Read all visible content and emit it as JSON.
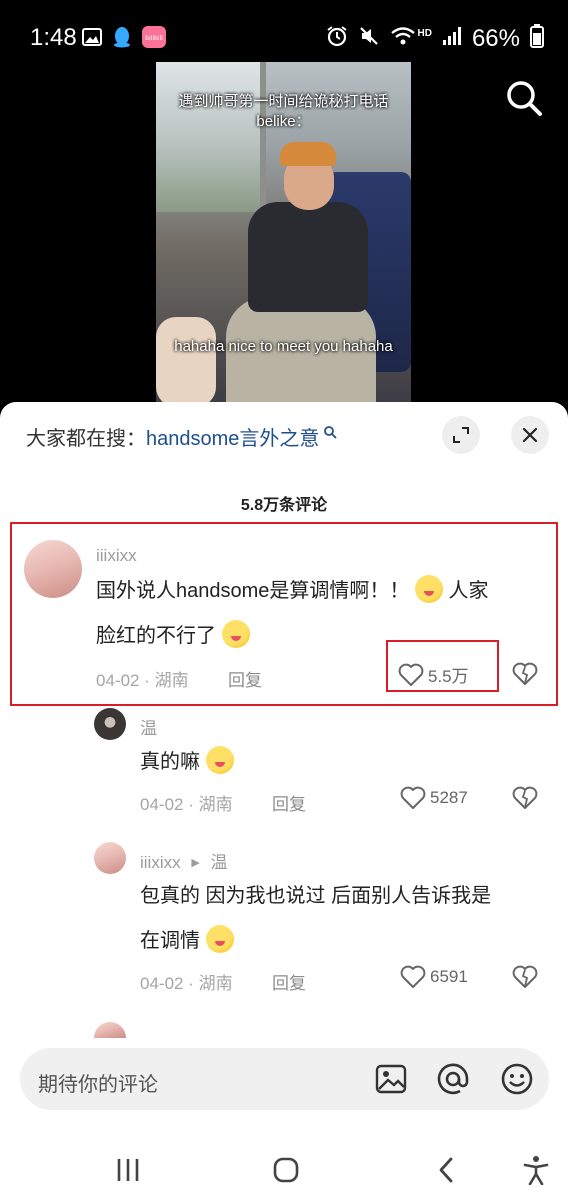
{
  "status_bar": {
    "time": "1:48",
    "battery_text": "66%",
    "network_label": "HD",
    "app_badge_text": "bilibili"
  },
  "video": {
    "caption_top": "遇到帅哥第一时间给诡秘打电话belike：",
    "caption_bottom": "hahaha nice to meet you hahaha"
  },
  "sheet": {
    "search_prefix": "大家都在搜：",
    "search_term": "handsome言外之意",
    "count_title": "5.8万条评论"
  },
  "comments": [
    {
      "username": "iiixixx",
      "text_line1": "国外说人handsome是算调情啊！！",
      "text_line1_after": "人家",
      "text_line2": "脸红的不行了",
      "date_location": "04-02 · 湖南",
      "reply_label": "回复",
      "likes": "5.5万"
    },
    {
      "username": "温",
      "text": "真的嘛",
      "date_location": "04-02 · 湖南",
      "reply_label": "回复",
      "likes": "5287"
    },
    {
      "username": "iiixixx",
      "reply_to": "温",
      "text_line1": "包真的 因为我也说过 后面别人告诉我是",
      "text_line2": "在调情",
      "date_location": "04-02 · 湖南",
      "reply_label": "回复",
      "likes": "6591"
    }
  ],
  "input": {
    "placeholder": "期待你的评论"
  },
  "colors": {
    "highlight": "#d81e2a",
    "search_term": "#1f4f8e"
  }
}
